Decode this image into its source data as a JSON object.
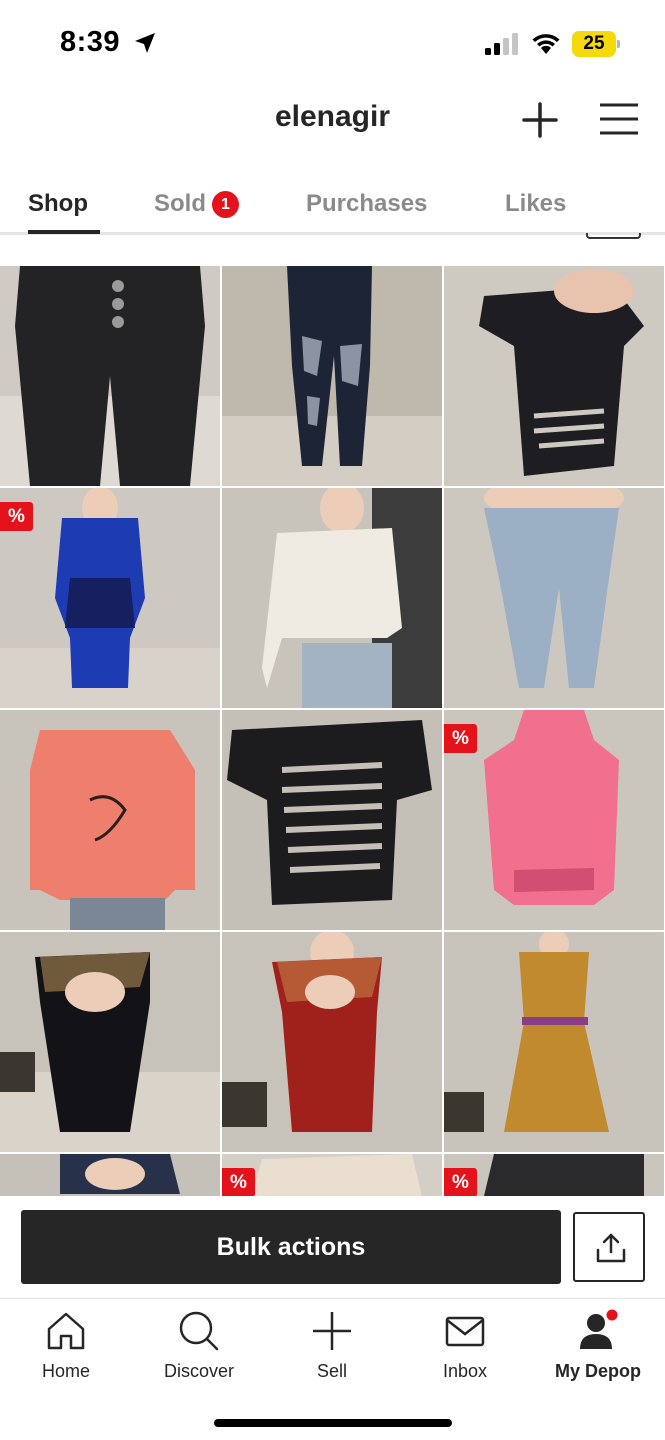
{
  "status_bar": {
    "time": "8:39",
    "battery": "25",
    "icons": [
      "location-arrow-icon",
      "signal-icon",
      "wifi-icon",
      "battery-icon"
    ]
  },
  "header": {
    "title": "elenagir",
    "icons": [
      "plus-icon",
      "hamburger-menu-icon"
    ]
  },
  "tabs": [
    {
      "label": "Shop",
      "active": true
    },
    {
      "label": "Sold",
      "badge": "1"
    },
    {
      "label": "Purchases"
    },
    {
      "label": "Likes"
    }
  ],
  "grid": {
    "discount_label": "%",
    "items": [
      {
        "name": "black high-waist jeans",
        "discount": false
      },
      {
        "name": "distressed dark jeans",
        "discount": false
      },
      {
        "name": "black cut-out top",
        "discount": false
      },
      {
        "name": "blue sleeveless dress",
        "discount": true
      },
      {
        "name": "white lace crop top",
        "discount": false
      },
      {
        "name": "light wash jeans",
        "discount": false
      },
      {
        "name": "coral hoodie",
        "discount": false
      },
      {
        "name": "black slashed top",
        "discount": false
      },
      {
        "name": "pink mesh top",
        "discount": true
      },
      {
        "name": "black cut-out dress",
        "discount": false
      },
      {
        "name": "red cut-out dress",
        "discount": false
      },
      {
        "name": "mustard sleeveless dress",
        "discount": false
      },
      {
        "name": "item 13",
        "discount": false
      },
      {
        "name": "item 14",
        "discount": true
      },
      {
        "name": "item 15",
        "discount": true
      }
    ]
  },
  "actions": {
    "bulk_label": "Bulk actions",
    "share_icon": "share-upload-icon"
  },
  "bottom_nav": [
    {
      "label": "Home",
      "icon": "home-icon"
    },
    {
      "label": "Discover",
      "icon": "search-icon"
    },
    {
      "label": "Sell",
      "icon": "plus-icon"
    },
    {
      "label": "Inbox",
      "icon": "mail-icon"
    },
    {
      "label": "My Depop",
      "icon": "profile-icon",
      "active": true
    }
  ],
  "colors": {
    "badge_red": "#e4121b",
    "text_dark": "#262626",
    "tab_inactive": "#8a8a8a",
    "battery_yellow": "#f5d90a"
  }
}
